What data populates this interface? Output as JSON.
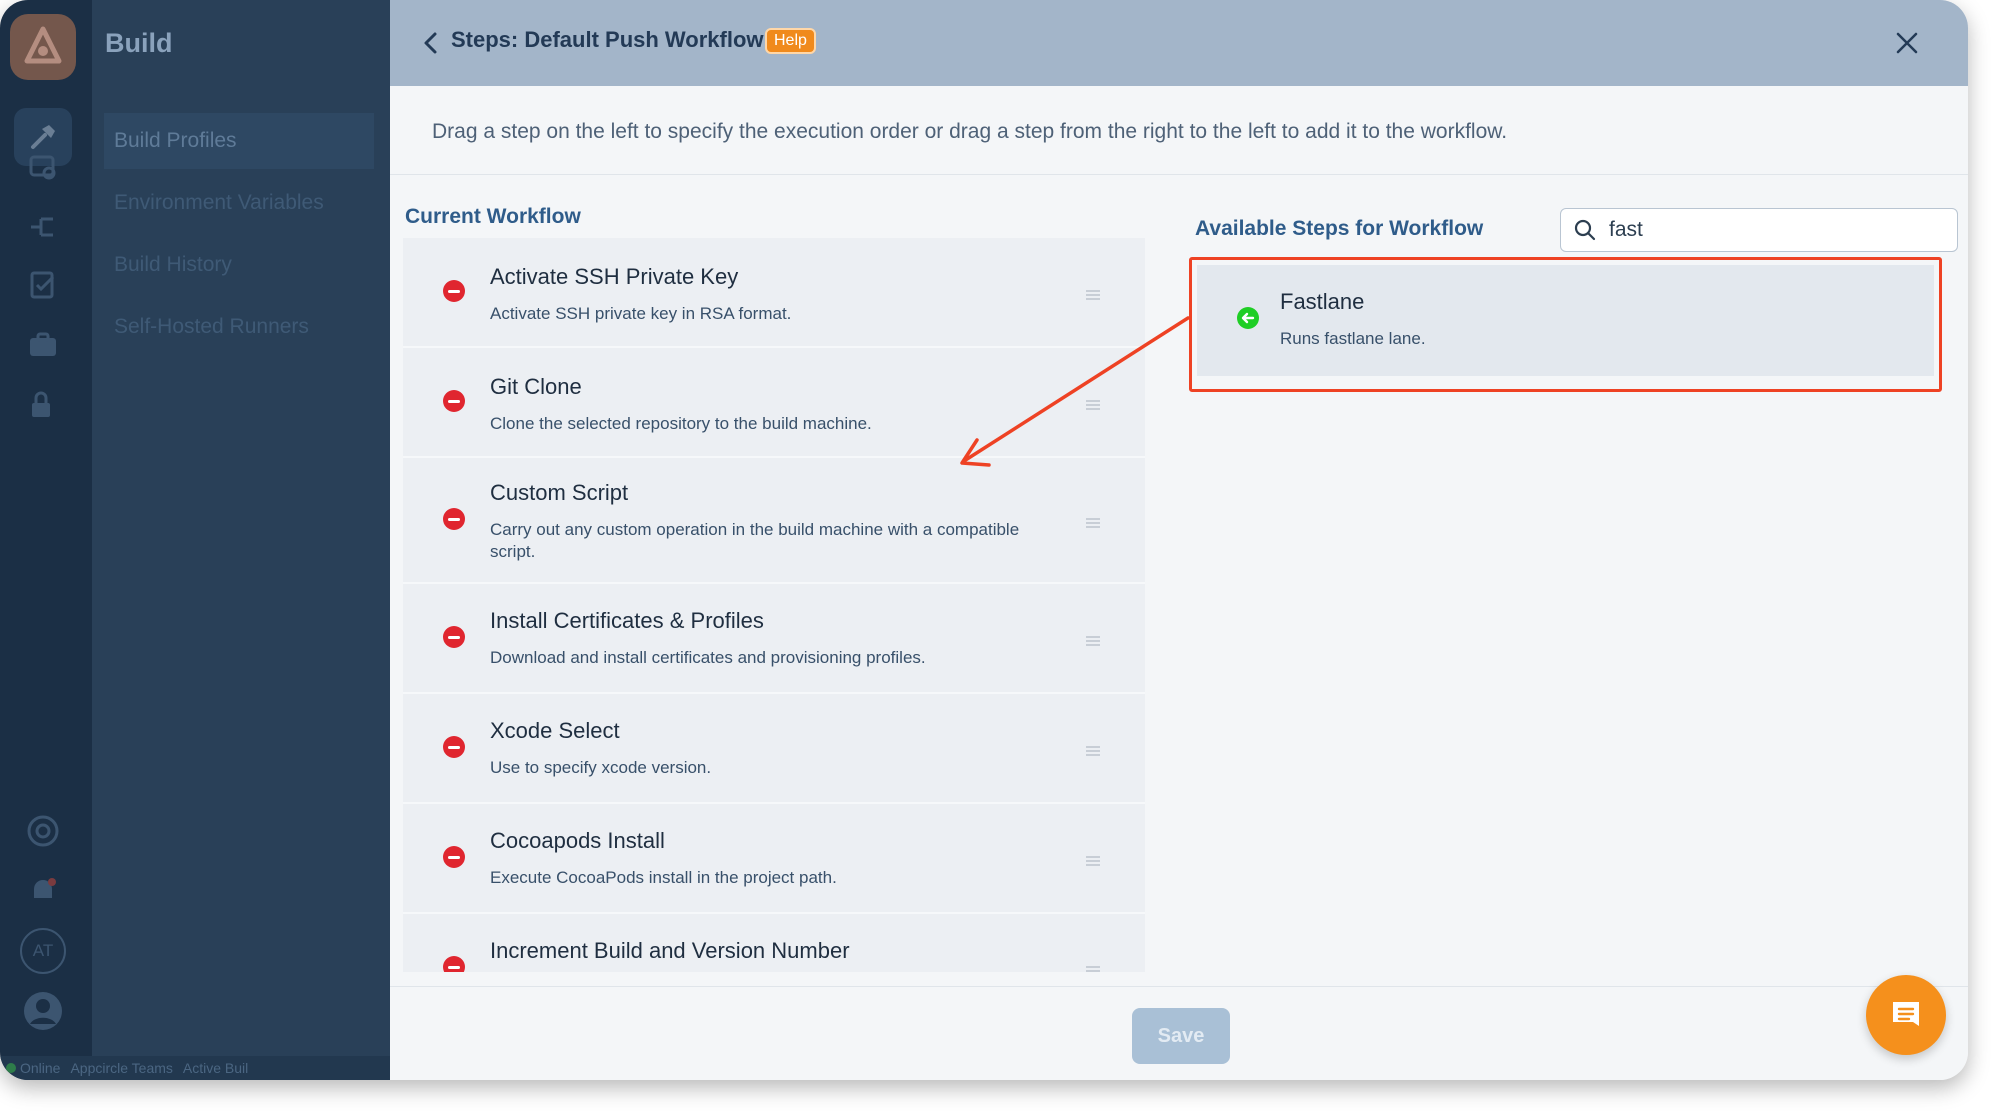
{
  "sidebar_nav": {
    "title": "Build",
    "items": [
      {
        "label": "Build Profiles"
      },
      {
        "label": "Environment Variables"
      },
      {
        "label": "Build History"
      },
      {
        "label": "Self-Hosted Runners"
      }
    ],
    "avatar_initials": "AT"
  },
  "statusbar": {
    "online": "Online",
    "team": "Appcircle Teams",
    "active": "Active Buil"
  },
  "modal": {
    "title": "Steps: Default Push Workflow",
    "help_label": "Help",
    "instructions": "Drag a step on the left to specify the execution order or drag a step from the right to the left to add it to the workflow."
  },
  "current_workflow": {
    "title": "Current Workflow",
    "steps": [
      {
        "name": "Activate SSH Private Key",
        "description": "Activate SSH private key in RSA format."
      },
      {
        "name": "Git Clone",
        "description": "Clone the selected repository to the build machine."
      },
      {
        "name": "Custom Script",
        "description": "Carry out any custom operation in the build machine with a compatible script."
      },
      {
        "name": "Install Certificates & Profiles",
        "description": "Download and install certificates and provisioning profiles."
      },
      {
        "name": "Xcode Select",
        "description": "Use to specify xcode version."
      },
      {
        "name": "Cocoapods Install",
        "description": "Execute CocoaPods install in the project path."
      },
      {
        "name": "Increment Build and Version Number",
        "description": ""
      }
    ]
  },
  "available_steps": {
    "title": "Available Steps for Workflow",
    "search_value": "fast",
    "steps": [
      {
        "name": "Fastlane",
        "description": "Runs fastlane lane."
      }
    ]
  },
  "footer": {
    "save_label": "Save"
  },
  "colors": {
    "remove": "#e0262f",
    "add": "#1fce25",
    "highlight": "#ee4224",
    "help_badge": "#f08a1c",
    "chat": "#f5901c"
  },
  "icons": [
    "logo-icon",
    "hammer-icon",
    "back-chevron-icon",
    "close-icon",
    "search-icon",
    "remove-step-icon",
    "add-step-icon",
    "drag-handle-icon",
    "chat-icon"
  ]
}
